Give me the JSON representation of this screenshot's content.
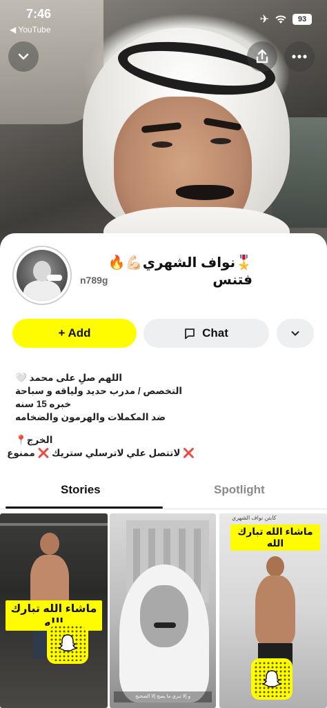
{
  "status_bar": {
    "time": "7:46",
    "back_app": "◀ YouTube",
    "battery": "93"
  },
  "profile": {
    "display_name": "🎖️نواف الشهري💪🏻🔥 فتنس",
    "username": "n789g"
  },
  "actions": {
    "add_label": "+ Add",
    "chat_label": "Chat"
  },
  "bio": {
    "line1": "اللهم صلِ على محمد 🤍",
    "line2": "التخصص  /  مدرب حديد ولياقه و سباحة",
    "line3": "خبره 15 سنه",
    "line4": "ضد المكملات والهرمون والضخامه",
    "line5": "الخرج📍",
    "line6": "❌ لاتتصل علي   لاترسلي ستريك ❌ ممنوع"
  },
  "tabs": {
    "stories": "Stories",
    "spotlight": "Spotlight"
  },
  "stories": [
    {
      "label": "ماشاء الله تبارك الله"
    },
    {
      "caption": "و إلا تبري ما يصح إلا الصحيح"
    },
    {
      "tag": "كابتن نواف الشهري",
      "label": "ماشاء الله تبارك الله"
    }
  ],
  "colors": {
    "accent_yellow": "#fffc00",
    "button_gray": "#eeeff1",
    "tab_inactive": "#8a8a8a"
  },
  "icons": [
    "chevron-down-icon",
    "share-icon",
    "more-icon",
    "chat-icon",
    "dropdown-chevron-icon",
    "ghost-icon"
  ]
}
